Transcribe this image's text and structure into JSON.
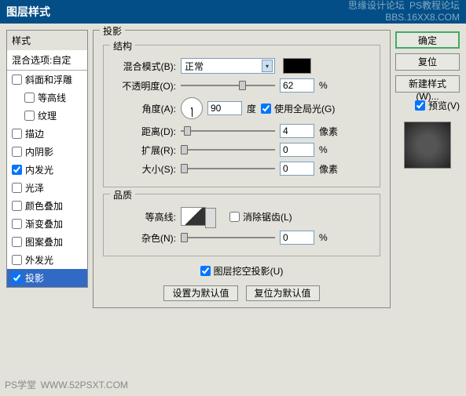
{
  "titlebar": {
    "title": "图层样式",
    "watermark1": "思缘设计论坛",
    "watermark2": "PS教程论坛",
    "watermark3": "BBS.16XX8.COM"
  },
  "styles": {
    "header": "样式",
    "subheader": "混合选项:自定",
    "items": [
      {
        "label": "斜面和浮雕",
        "checked": false,
        "indent": false
      },
      {
        "label": "等高线",
        "checked": false,
        "indent": true
      },
      {
        "label": "纹理",
        "checked": false,
        "indent": true
      },
      {
        "label": "描边",
        "checked": false,
        "indent": false
      },
      {
        "label": "内阴影",
        "checked": false,
        "indent": false
      },
      {
        "label": "内发光",
        "checked": true,
        "indent": false
      },
      {
        "label": "光泽",
        "checked": false,
        "indent": false
      },
      {
        "label": "颜色叠加",
        "checked": false,
        "indent": false
      },
      {
        "label": "渐变叠加",
        "checked": false,
        "indent": false
      },
      {
        "label": "图案叠加",
        "checked": false,
        "indent": false
      },
      {
        "label": "外发光",
        "checked": false,
        "indent": false
      },
      {
        "label": "投影",
        "checked": true,
        "indent": false,
        "selected": true
      }
    ]
  },
  "main": {
    "panel_title": "投影",
    "structure": {
      "legend": "结构",
      "blend_mode_label": "混合模式(B):",
      "blend_mode_value": "正常",
      "opacity_label": "不透明度(O):",
      "opacity_value": "62",
      "opacity_unit": "%",
      "angle_label": "角度(A):",
      "angle_value": "90",
      "angle_unit": "度",
      "global_light_label": "使用全局光(G)",
      "distance_label": "距离(D):",
      "distance_value": "4",
      "distance_unit": "像素",
      "spread_label": "扩展(R):",
      "spread_value": "0",
      "spread_unit": "%",
      "size_label": "大小(S):",
      "size_value": "0",
      "size_unit": "像素"
    },
    "quality": {
      "legend": "品质",
      "contour_label": "等高线:",
      "antialias_label": "消除锯齿(L)",
      "noise_label": "杂色(N):",
      "noise_value": "0",
      "noise_unit": "%"
    },
    "knockout_label": "图层挖空投影(U)",
    "default_btn": "设置为默认值",
    "reset_btn": "复位为默认值"
  },
  "right": {
    "ok": "确定",
    "cancel": "复位",
    "new_style": "新建样式(W)...",
    "preview_label": "预览(V)"
  },
  "footer": {
    "ps": "PS学堂",
    "url": "WWW.52PSXT.COM"
  }
}
